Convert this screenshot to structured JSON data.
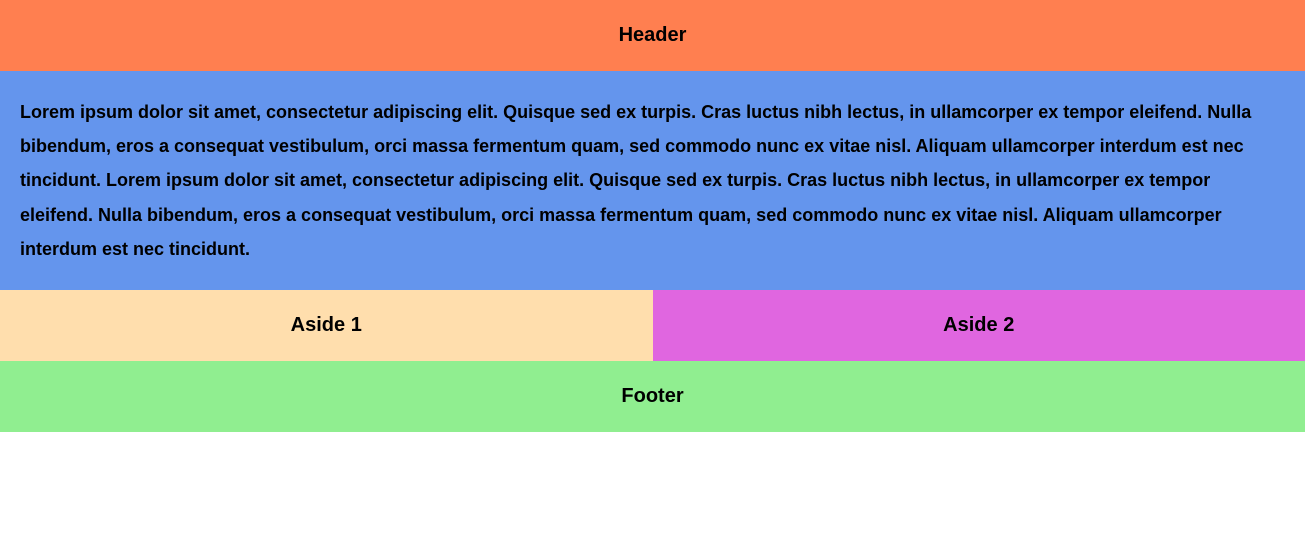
{
  "header": {
    "title": "Header"
  },
  "main": {
    "content": "Lorem ipsum dolor sit amet, consectetur adipiscing elit. Quisque sed ex turpis. Cras luctus nibh lectus, in ullamcorper ex tempor eleifend. Nulla bibendum, eros a consequat vestibulum, orci massa fermentum quam, sed commodo nunc ex vitae nisl. Aliquam ullamcorper interdum est nec tincidunt. Lorem ipsum dolor sit amet, consectetur adipiscing elit. Quisque sed ex turpis. Cras luctus nibh lectus, in ullamcorper ex tempor eleifend. Nulla bibendum, eros a consequat vestibulum, orci massa fermentum quam, sed commodo nunc ex vitae nisl. Aliquam ullamcorper interdum est nec tincidunt."
  },
  "aside1": {
    "label": "Aside 1"
  },
  "aside2": {
    "label": "Aside 2"
  },
  "footer": {
    "label": "Footer"
  },
  "colors": {
    "header": "#ff7f50",
    "main": "#6495ed",
    "aside1": "#ffdead",
    "aside2": "#e066e0",
    "footer": "#90ee90"
  }
}
